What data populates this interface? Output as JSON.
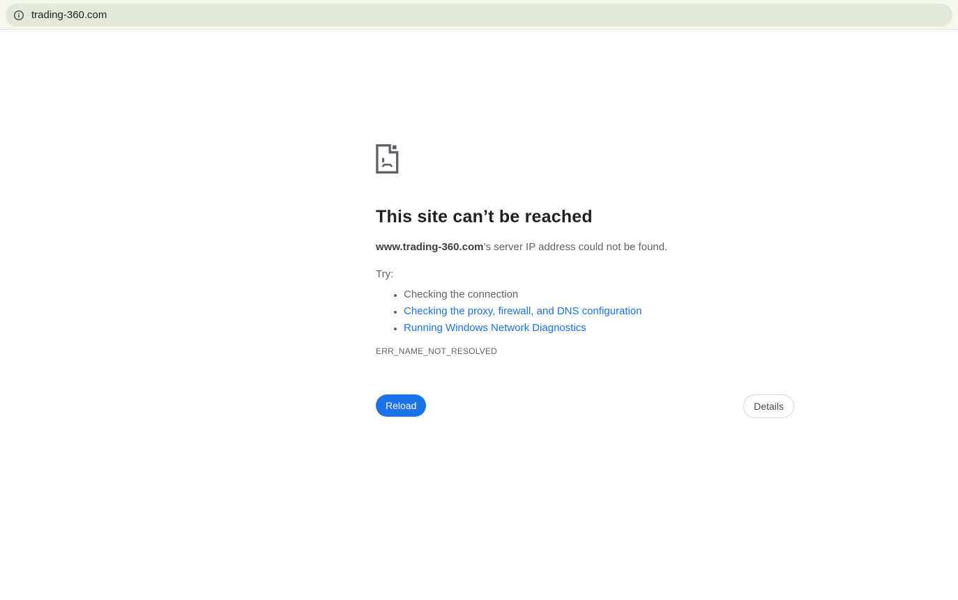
{
  "browser": {
    "url": "trading-360.com",
    "info_icon": "info-icon"
  },
  "error_page": {
    "title": "This site can’t be reached",
    "domain": "www.trading-360.com",
    "message_rest": "’s server IP address could not be found.",
    "try_label": "Try:",
    "suggestions": [
      {
        "label": "Checking the connection",
        "is_link": false
      },
      {
        "label": "Checking the proxy, firewall, and DNS configuration",
        "is_link": true
      },
      {
        "label": "Running Windows Network Diagnostics",
        "is_link": true
      }
    ],
    "error_code": "ERR_NAME_NOT_RESOLVED",
    "reload_label": "Reload",
    "details_label": "Details"
  },
  "colors": {
    "accent_blue": "#1a73e8",
    "link_blue": "#1a73e8",
    "toolbar_background": "#f4f7eb",
    "address_pill_background": "#e3e9da",
    "title_text": "#202124",
    "body_text": "#5f6368"
  }
}
